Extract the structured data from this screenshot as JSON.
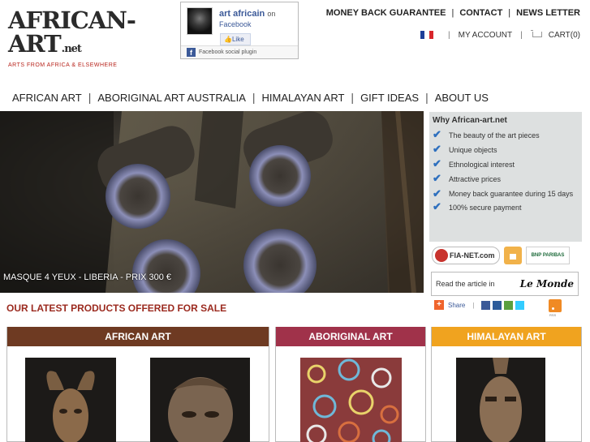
{
  "logo": {
    "line1": "AFRICAN-",
    "line2": "ART",
    "suffix": ".net",
    "tagline": "ARTS FROM AFRICA & ELSEWHERE"
  },
  "facebook": {
    "page_name": "art africain",
    "on_text": "on",
    "sub_text": "Facebook",
    "like_label": "Like",
    "plugin_label": "Facebook social plugin"
  },
  "toplinks": [
    "MONEY BACK GUARANTEE",
    "CONTACT",
    "NEWS LETTER"
  ],
  "account": {
    "my_account": "MY ACCOUNT",
    "cart": "CART(0)",
    "flag_colors": [
      "#1e3f99",
      "#ffffff",
      "#d8262b"
    ]
  },
  "nav": [
    "AFRICAN ART",
    "ABORIGINAL ART AUSTRALIA",
    "HIMALAYAN ART",
    "GIFT IDEAS",
    "ABOUT US"
  ],
  "hero": {
    "caption": "MASQUE 4 YEUX - LIBERIA - PRIX 300 €"
  },
  "why": {
    "title": "Why African-art.net",
    "items": [
      "The beauty of the art pieces",
      "Unique objects",
      "Ethnological interest",
      "Attractive prices",
      "Money back guarantee during 15 days",
      "100% secure payment"
    ]
  },
  "trust": {
    "fianet": "FIA-NET.com",
    "bnp": "BNP PARIBAS"
  },
  "press": {
    "text": "Read the article in",
    "brand": "Le Monde"
  },
  "latest_title": "OUR LATEST PRODUCTS OFFERED FOR SALE",
  "share": {
    "label": "Share"
  },
  "rss_label": "RSS",
  "categories": [
    {
      "title": "AFRICAN ART",
      "color": "#6e3a22"
    },
    {
      "title": "ABORIGINAL ART",
      "color": "#a0324a"
    },
    {
      "title": "HIMALAYAN ART",
      "color": "#f0a31f"
    }
  ]
}
